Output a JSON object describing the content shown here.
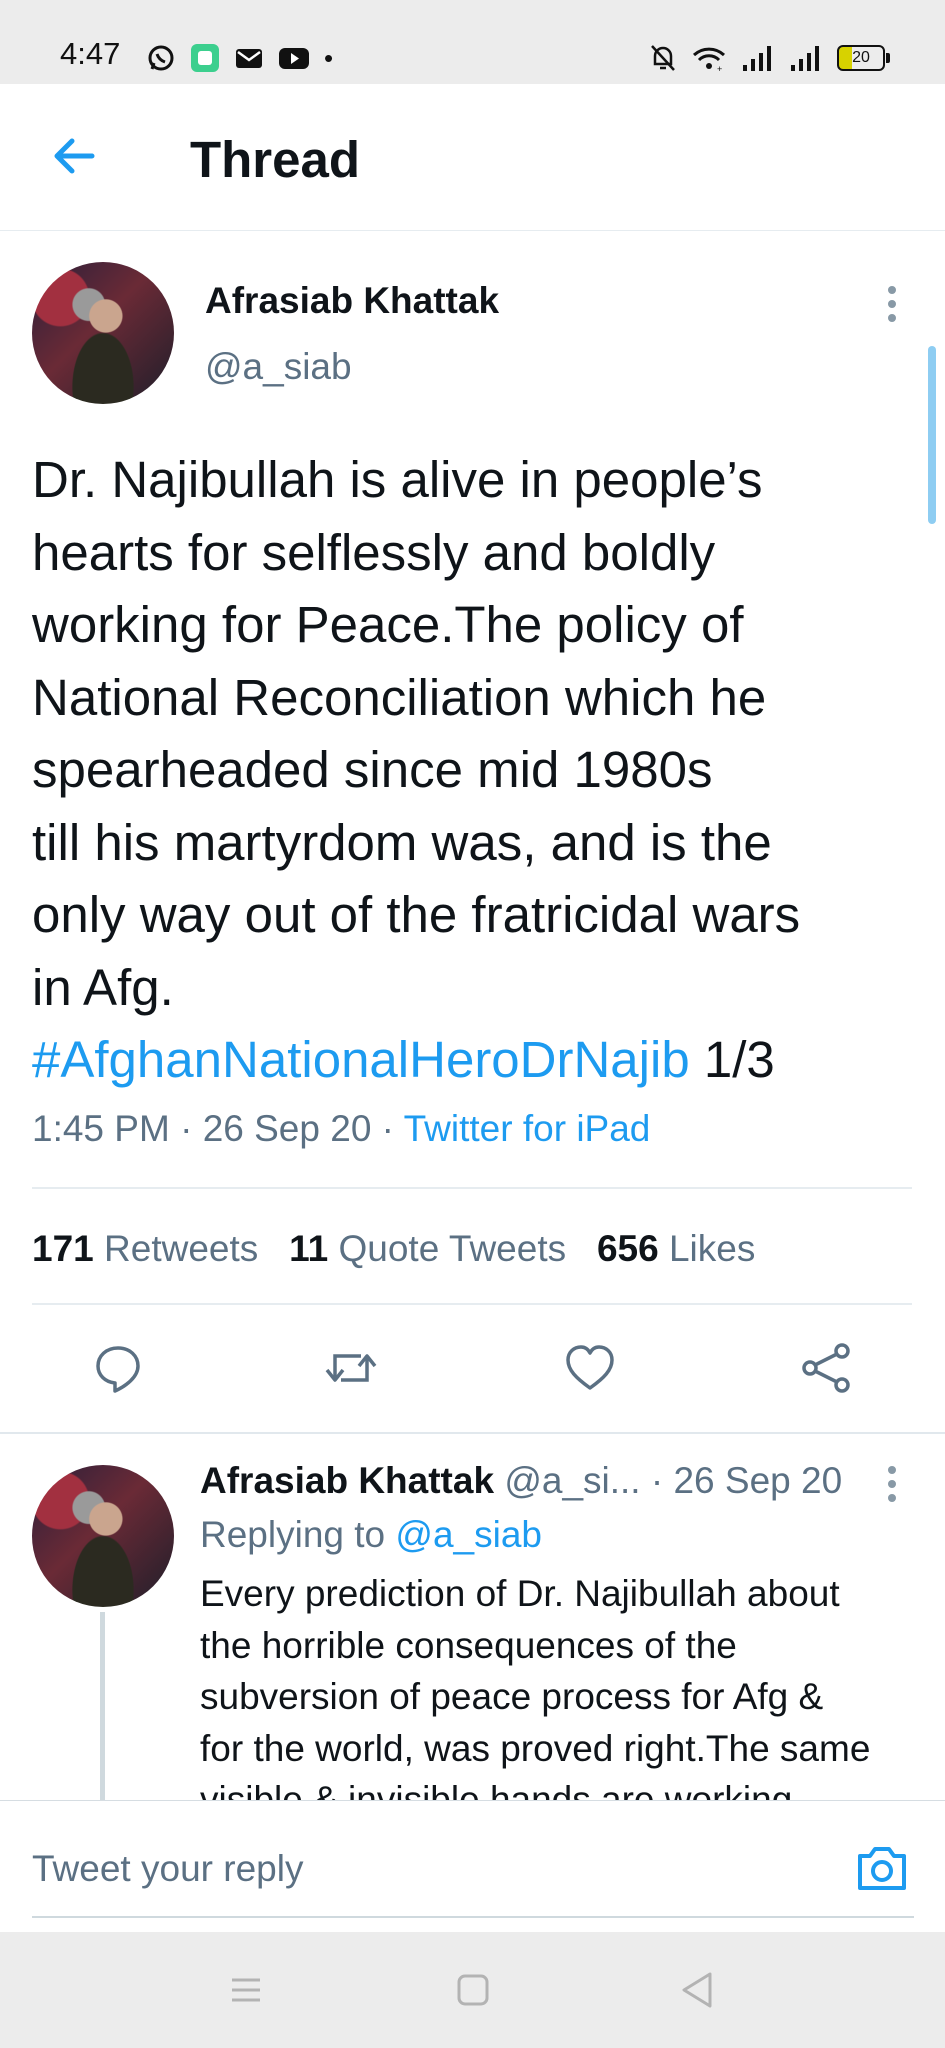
{
  "status_bar": {
    "time": "4:47",
    "battery": "20"
  },
  "header": {
    "title": "Thread"
  },
  "main_tweet": {
    "author_name": "Afrasiab Khattak",
    "handle": "@a_siab",
    "text": "Dr. Najibullah is alive in people’s\nhearts for selflessly and boldly\nworking for Peace.The policy of\nNational Reconciliation which he\nspearheaded since mid 1980s\ntill his martyrdom was, and is the\nonly way out of the fratricidal wars\nin Afg.",
    "hashtag": "#AfghanNationalHeroDrNajib",
    "hashtag_suffix": " 1/3",
    "time": "1:45 PM",
    "date": "26 Sep 20",
    "source": "Twitter for iPad",
    "retweets_count": "171",
    "retweets_label": "Retweets",
    "quotes_count": "11",
    "quotes_label": "Quote Tweets",
    "likes_count": "656",
    "likes_label": "Likes"
  },
  "reply_tweet": {
    "author_name": "Afrasiab Khattak",
    "handle": "@a_si...",
    "date": "· 26 Sep 20",
    "replying_prefix": "Replying to ",
    "replying_handle": "@a_siab",
    "text": "Every prediction of Dr. Najibullah about\nthe horrible consequences of the\nsubversion of peace process for Afg &\nfor the world, was proved right.The same\nvisible & invisible hands are working"
  },
  "reply_bar": {
    "placeholder": "Tweet your reply"
  },
  "colors": {
    "accent": "#1d9bf0",
    "muted": "#5b7083",
    "text": "#0f1419"
  }
}
